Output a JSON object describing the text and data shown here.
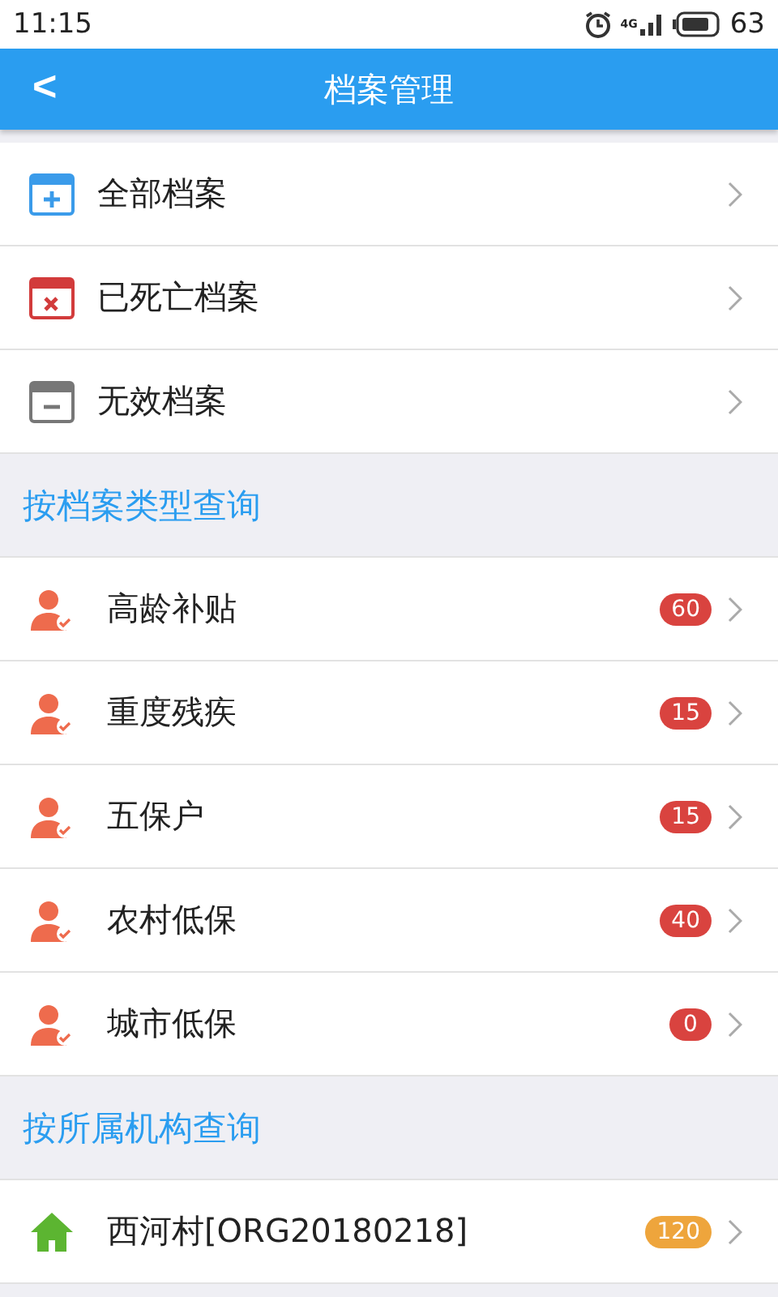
{
  "status_bar": {
    "time": "11:15",
    "network": "4G",
    "battery": "63"
  },
  "app_bar": {
    "title": "档案管理",
    "back": "<"
  },
  "archives": [
    {
      "kind": "all",
      "label": "全部档案"
    },
    {
      "kind": "deceased",
      "label": "已死亡档案"
    },
    {
      "kind": "invalid",
      "label": "无效档案"
    }
  ],
  "type_section": {
    "title": "按档案类型查询",
    "items": [
      {
        "label": "高龄补贴",
        "count": "60",
        "color": "#d9433f"
      },
      {
        "label": "重度残疾",
        "count": "15",
        "color": "#d9433f"
      },
      {
        "label": "五保户",
        "count": "15",
        "color": "#d9433f"
      },
      {
        "label": "农村低保",
        "count": "40",
        "color": "#d9433f"
      },
      {
        "label": "城市低保",
        "count": "0",
        "color": "#d9433f"
      }
    ]
  },
  "org_section": {
    "title": "按所属机构查询",
    "items": [
      {
        "label": "西河村[ORG20180218]",
        "count": "120",
        "color": "#eea53c"
      }
    ]
  }
}
